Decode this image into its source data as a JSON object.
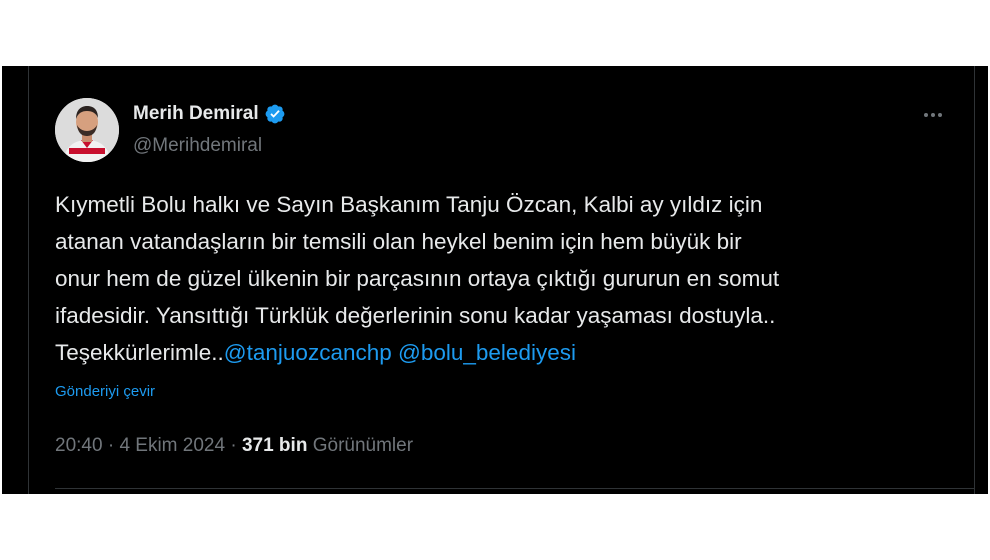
{
  "author": {
    "display_name": "Merih Demiral",
    "handle": "@Merihdemiral",
    "verified": true
  },
  "tweet": {
    "lines": [
      "Kıymetli Bolu halkı ve Sayın Başkanım Tanju Özcan, Kalbi ay yıldız için",
      "atanan vatandaşların bir temsili olan heykel benim için hem büyük bir",
      "onur hem de güzel ülkenin bir parçasının ortaya çıktığı gururun en somut",
      "ifadesidir. Yansıttığı Türklük değerlerinin sonu kadar yaşaması dostuyla..",
      "Teşekkürlerimle.."
    ],
    "mentions": [
      "@tanjuozcanchp",
      "@bolu_belediyesi"
    ],
    "translate_label": "Gönderiyi çevir"
  },
  "meta": {
    "time": "20:40",
    "separator": " · ",
    "date": "4 Ekim 2024",
    "views_count": "371 bin",
    "views_label": "Görünümler"
  },
  "icons": {
    "verified": "verified-badge-icon",
    "more": "more-options-icon"
  },
  "colors": {
    "background": "#000000",
    "text_primary": "#e7e9ea",
    "text_secondary": "#71767b",
    "accent": "#1d9bf0",
    "border": "#2f3336"
  }
}
